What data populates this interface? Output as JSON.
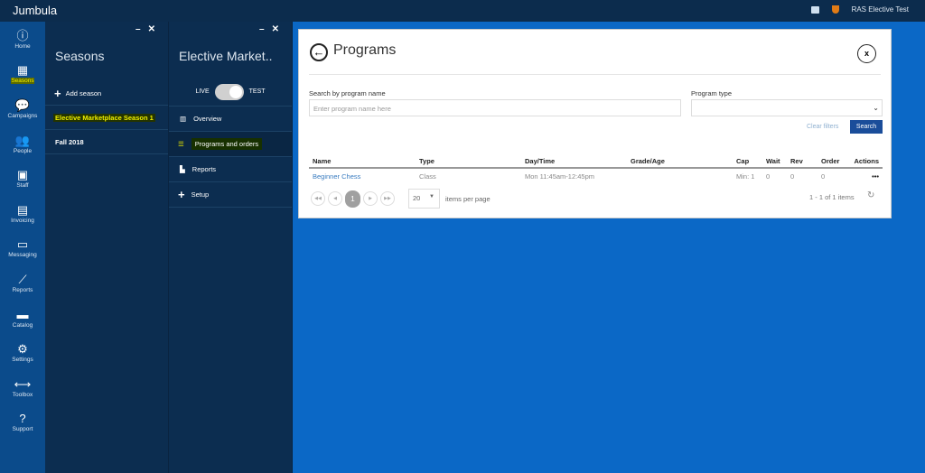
{
  "app": {
    "brand": "Jumbula",
    "account": "RAS Elective Test"
  },
  "nav": [
    {
      "label": "Home",
      "icon": "ⓘ"
    },
    {
      "label": "Seasons",
      "icon": "▦"
    },
    {
      "label": "Campaigns",
      "icon": "💬"
    },
    {
      "label": "People",
      "icon": "👥"
    },
    {
      "label": "Staff",
      "icon": "▣"
    },
    {
      "label": "Invoicing",
      "icon": "▤"
    },
    {
      "label": "Messaging",
      "icon": "▭"
    },
    {
      "label": "Reports",
      "icon": "⟋"
    },
    {
      "label": "Catalog",
      "icon": "▬"
    },
    {
      "label": "Settings",
      "icon": "⚙"
    },
    {
      "label": "Toolbox",
      "icon": "⟷"
    },
    {
      "label": "Support",
      "icon": "?"
    }
  ],
  "seasons": {
    "title": "Seasons",
    "add": "Add season",
    "items": [
      "Elective Marketplace Season 1",
      "Fall 2018"
    ]
  },
  "season_panel": {
    "title": "Elective Market..",
    "live": "LIVE",
    "test": "TEST",
    "items": [
      "Overview",
      "Programs and orders",
      "Reports",
      "Setup"
    ]
  },
  "programs": {
    "title": "Programs",
    "search_label": "Search by program name",
    "search_placeholder": "Enter program name here",
    "type_label": "Program type",
    "clear": "Clear filters",
    "search_btn": "Search",
    "columns": [
      "Name",
      "Type",
      "Day/Time",
      "Grade/Age",
      "Cap",
      "Wait",
      "Rev",
      "Order",
      "Actions"
    ],
    "rows": [
      [
        "Beginner Chess",
        "Class",
        "Mon 11:45am-12:45pm",
        "",
        "Min: 1",
        "0",
        "0",
        "0",
        "•••"
      ]
    ],
    "page": "1",
    "page_size": "20",
    "items_per_page": "items per page",
    "count": "1 - 1 of 1 items"
  }
}
